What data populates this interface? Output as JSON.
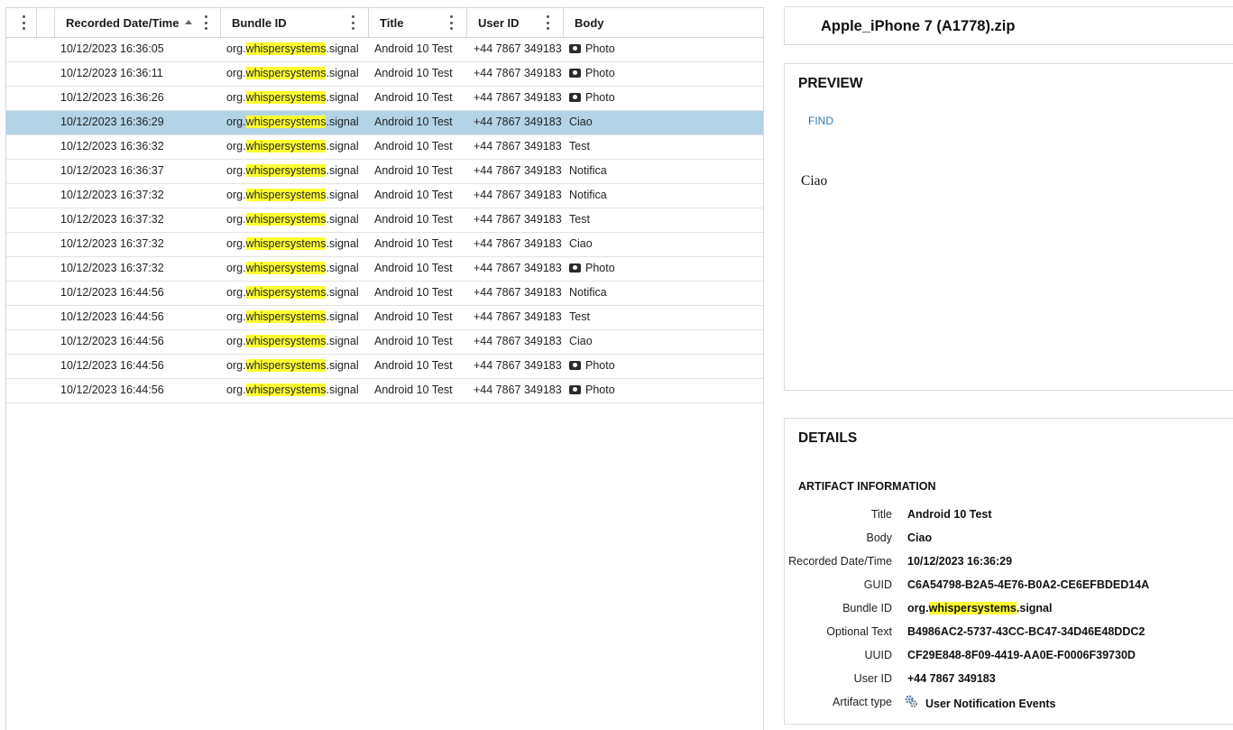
{
  "grid": {
    "columns": {
      "recorded": "Recorded Date/Time",
      "bundle": "Bundle ID",
      "title": "Title",
      "user": "User ID",
      "body": "Body"
    },
    "rows": [
      {
        "date": "10/12/2023 16:36:05",
        "bundle_pre": "org.",
        "bundle_hl": "whispersystems",
        "bundle_post": ".signal",
        "title": "Android 10 Test",
        "user": "+44 7867 349183",
        "body": "Photo",
        "photo": true,
        "selected": false
      },
      {
        "date": "10/12/2023 16:36:11",
        "bundle_pre": "org.",
        "bundle_hl": "whispersystems",
        "bundle_post": ".signal",
        "title": "Android 10 Test",
        "user": "+44 7867 349183",
        "body": "Photo",
        "photo": true,
        "selected": false
      },
      {
        "date": "10/12/2023 16:36:26",
        "bundle_pre": "org.",
        "bundle_hl": "whispersystems",
        "bundle_post": ".signal",
        "title": "Android 10 Test",
        "user": "+44 7867 349183",
        "body": "Photo",
        "photo": true,
        "selected": false
      },
      {
        "date": "10/12/2023 16:36:29",
        "bundle_pre": "org.",
        "bundle_hl": "whispersystems",
        "bundle_post": ".signal",
        "title": "Android 10 Test",
        "user": "+44 7867 349183",
        "body": "Ciao",
        "photo": false,
        "selected": true
      },
      {
        "date": "10/12/2023 16:36:32",
        "bundle_pre": "org.",
        "bundle_hl": "whispersystems",
        "bundle_post": ".signal",
        "title": "Android 10 Test",
        "user": "+44 7867 349183",
        "body": "Test",
        "photo": false,
        "selected": false
      },
      {
        "date": "10/12/2023 16:36:37",
        "bundle_pre": "org.",
        "bundle_hl": "whispersystems",
        "bundle_post": ".signal",
        "title": "Android 10 Test",
        "user": "+44 7867 349183",
        "body": "Notifica",
        "photo": false,
        "selected": false
      },
      {
        "date": "10/12/2023 16:37:32",
        "bundle_pre": "org.",
        "bundle_hl": "whispersystems",
        "bundle_post": ".signal",
        "title": "Android 10 Test",
        "user": "+44 7867 349183",
        "body": "Notifica",
        "photo": false,
        "selected": false
      },
      {
        "date": "10/12/2023 16:37:32",
        "bundle_pre": "org.",
        "bundle_hl": "whispersystems",
        "bundle_post": ".signal",
        "title": "Android 10 Test",
        "user": "+44 7867 349183",
        "body": "Test",
        "photo": false,
        "selected": false
      },
      {
        "date": "10/12/2023 16:37:32",
        "bundle_pre": "org.",
        "bundle_hl": "whispersystems",
        "bundle_post": ".signal",
        "title": "Android 10 Test",
        "user": "+44 7867 349183",
        "body": "Ciao",
        "photo": false,
        "selected": false
      },
      {
        "date": "10/12/2023 16:37:32",
        "bundle_pre": "org.",
        "bundle_hl": "whispersystems",
        "bundle_post": ".signal",
        "title": "Android 10 Test",
        "user": "+44 7867 349183",
        "body": "Photo",
        "photo": true,
        "selected": false
      },
      {
        "date": "10/12/2023 16:44:56",
        "bundle_pre": "org.",
        "bundle_hl": "whispersystems",
        "bundle_post": ".signal",
        "title": "Android 10 Test",
        "user": "+44 7867 349183",
        "body": "Notifica",
        "photo": false,
        "selected": false
      },
      {
        "date": "10/12/2023 16:44:56",
        "bundle_pre": "org.",
        "bundle_hl": "whispersystems",
        "bundle_post": ".signal",
        "title": "Android 10 Test",
        "user": "+44 7867 349183",
        "body": "Test",
        "photo": false,
        "selected": false
      },
      {
        "date": "10/12/2023 16:44:56",
        "bundle_pre": "org.",
        "bundle_hl": "whispersystems",
        "bundle_post": ".signal",
        "title": "Android 10 Test",
        "user": "+44 7867 349183",
        "body": "Ciao",
        "photo": false,
        "selected": false
      },
      {
        "date": "10/12/2023 16:44:56",
        "bundle_pre": "org.",
        "bundle_hl": "whispersystems",
        "bundle_post": ".signal",
        "title": "Android 10 Test",
        "user": "+44 7867 349183",
        "body": "Photo",
        "photo": true,
        "selected": false
      },
      {
        "date": "10/12/2023 16:44:56",
        "bundle_pre": "org.",
        "bundle_hl": "whispersystems",
        "bundle_post": ".signal",
        "title": "Android 10 Test",
        "user": "+44 7867 349183",
        "body": "Photo",
        "photo": true,
        "selected": false
      }
    ]
  },
  "file": {
    "name": "Apple_iPhone 7 (A1778).zip"
  },
  "preview": {
    "title": "PREVIEW",
    "find": "FIND",
    "text": "Ciao"
  },
  "details": {
    "title": "DETAILS",
    "section": "ARTIFACT INFORMATION",
    "fields": [
      {
        "label": "Title",
        "value": "Android 10 Test"
      },
      {
        "label": "Body",
        "value": "Ciao"
      },
      {
        "label": "Recorded Date/Time",
        "value": "10/12/2023 16:36:29"
      },
      {
        "label": "GUID",
        "value": "C6A54798-B2A5-4E76-B0A2-CE6EFBDED14A"
      },
      {
        "label": "Bundle ID",
        "value_pre": "org.",
        "value_hl": "whispersystems",
        "value_post": ".signal"
      },
      {
        "label": "Optional Text",
        "value": "B4986AC2-5737-43CC-BC47-34D46E48DDC2"
      },
      {
        "label": "UUID",
        "value": "CF29E848-8F09-4419-AA0E-F0006F39730D"
      },
      {
        "label": "User ID",
        "value": "+44 7867 349183"
      }
    ],
    "artifact_type": {
      "label": "Artifact type",
      "value": "User Notification Events",
      "icon": "gear-icon"
    }
  },
  "colors": {
    "selected_row": "#b3d4e7",
    "highlight": "#ffff33",
    "link": "#3a78a8"
  }
}
